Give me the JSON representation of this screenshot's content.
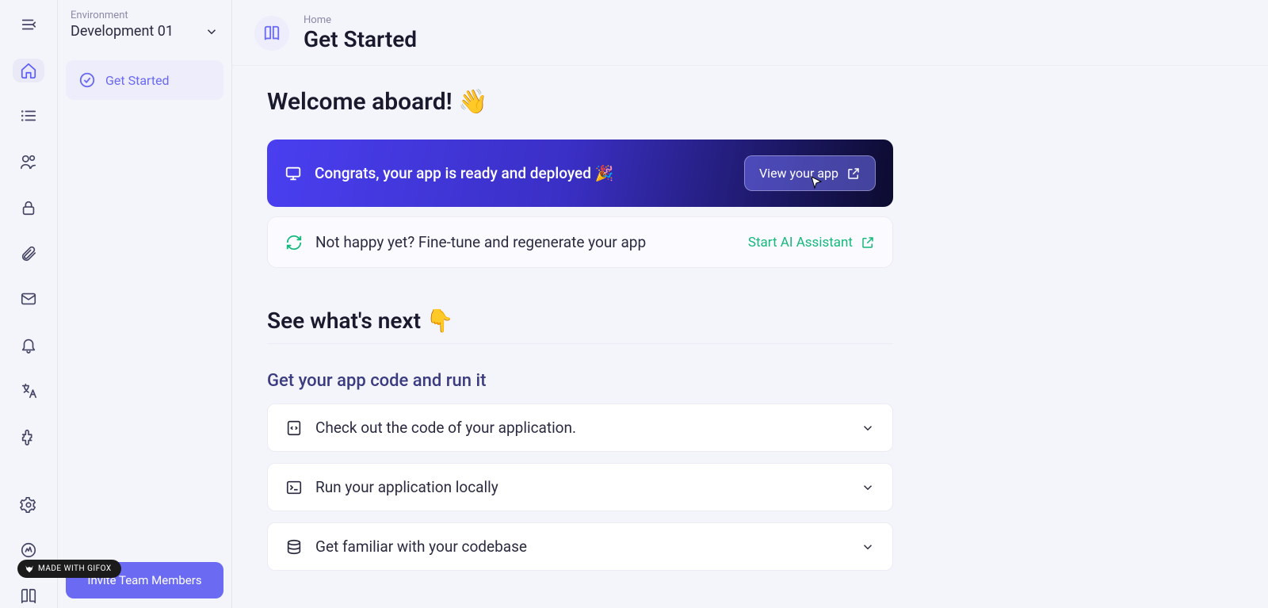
{
  "sidebar": {
    "env_label": "Environment",
    "env_name": "Development 01",
    "item_label": "Get Started",
    "invite_label": "Invite Team Members"
  },
  "header": {
    "breadcrumb": "Home",
    "title": "Get Started"
  },
  "main": {
    "welcome": "Welcome aboard! 👋",
    "banner_text": "Congrats, your app is ready and deployed 🎉",
    "view_app": "View your app",
    "finetune_text": "Not happy yet? Fine-tune and regenerate your app",
    "ai_link": "Start AI Assistant",
    "next_heading": "See what's next 👇",
    "section_heading": "Get your app code and run it",
    "acc": [
      "Check out the code of your application.",
      "Run your application locally",
      "Get familiar with your codebase"
    ]
  },
  "badge": "MADE WITH GIFOX"
}
